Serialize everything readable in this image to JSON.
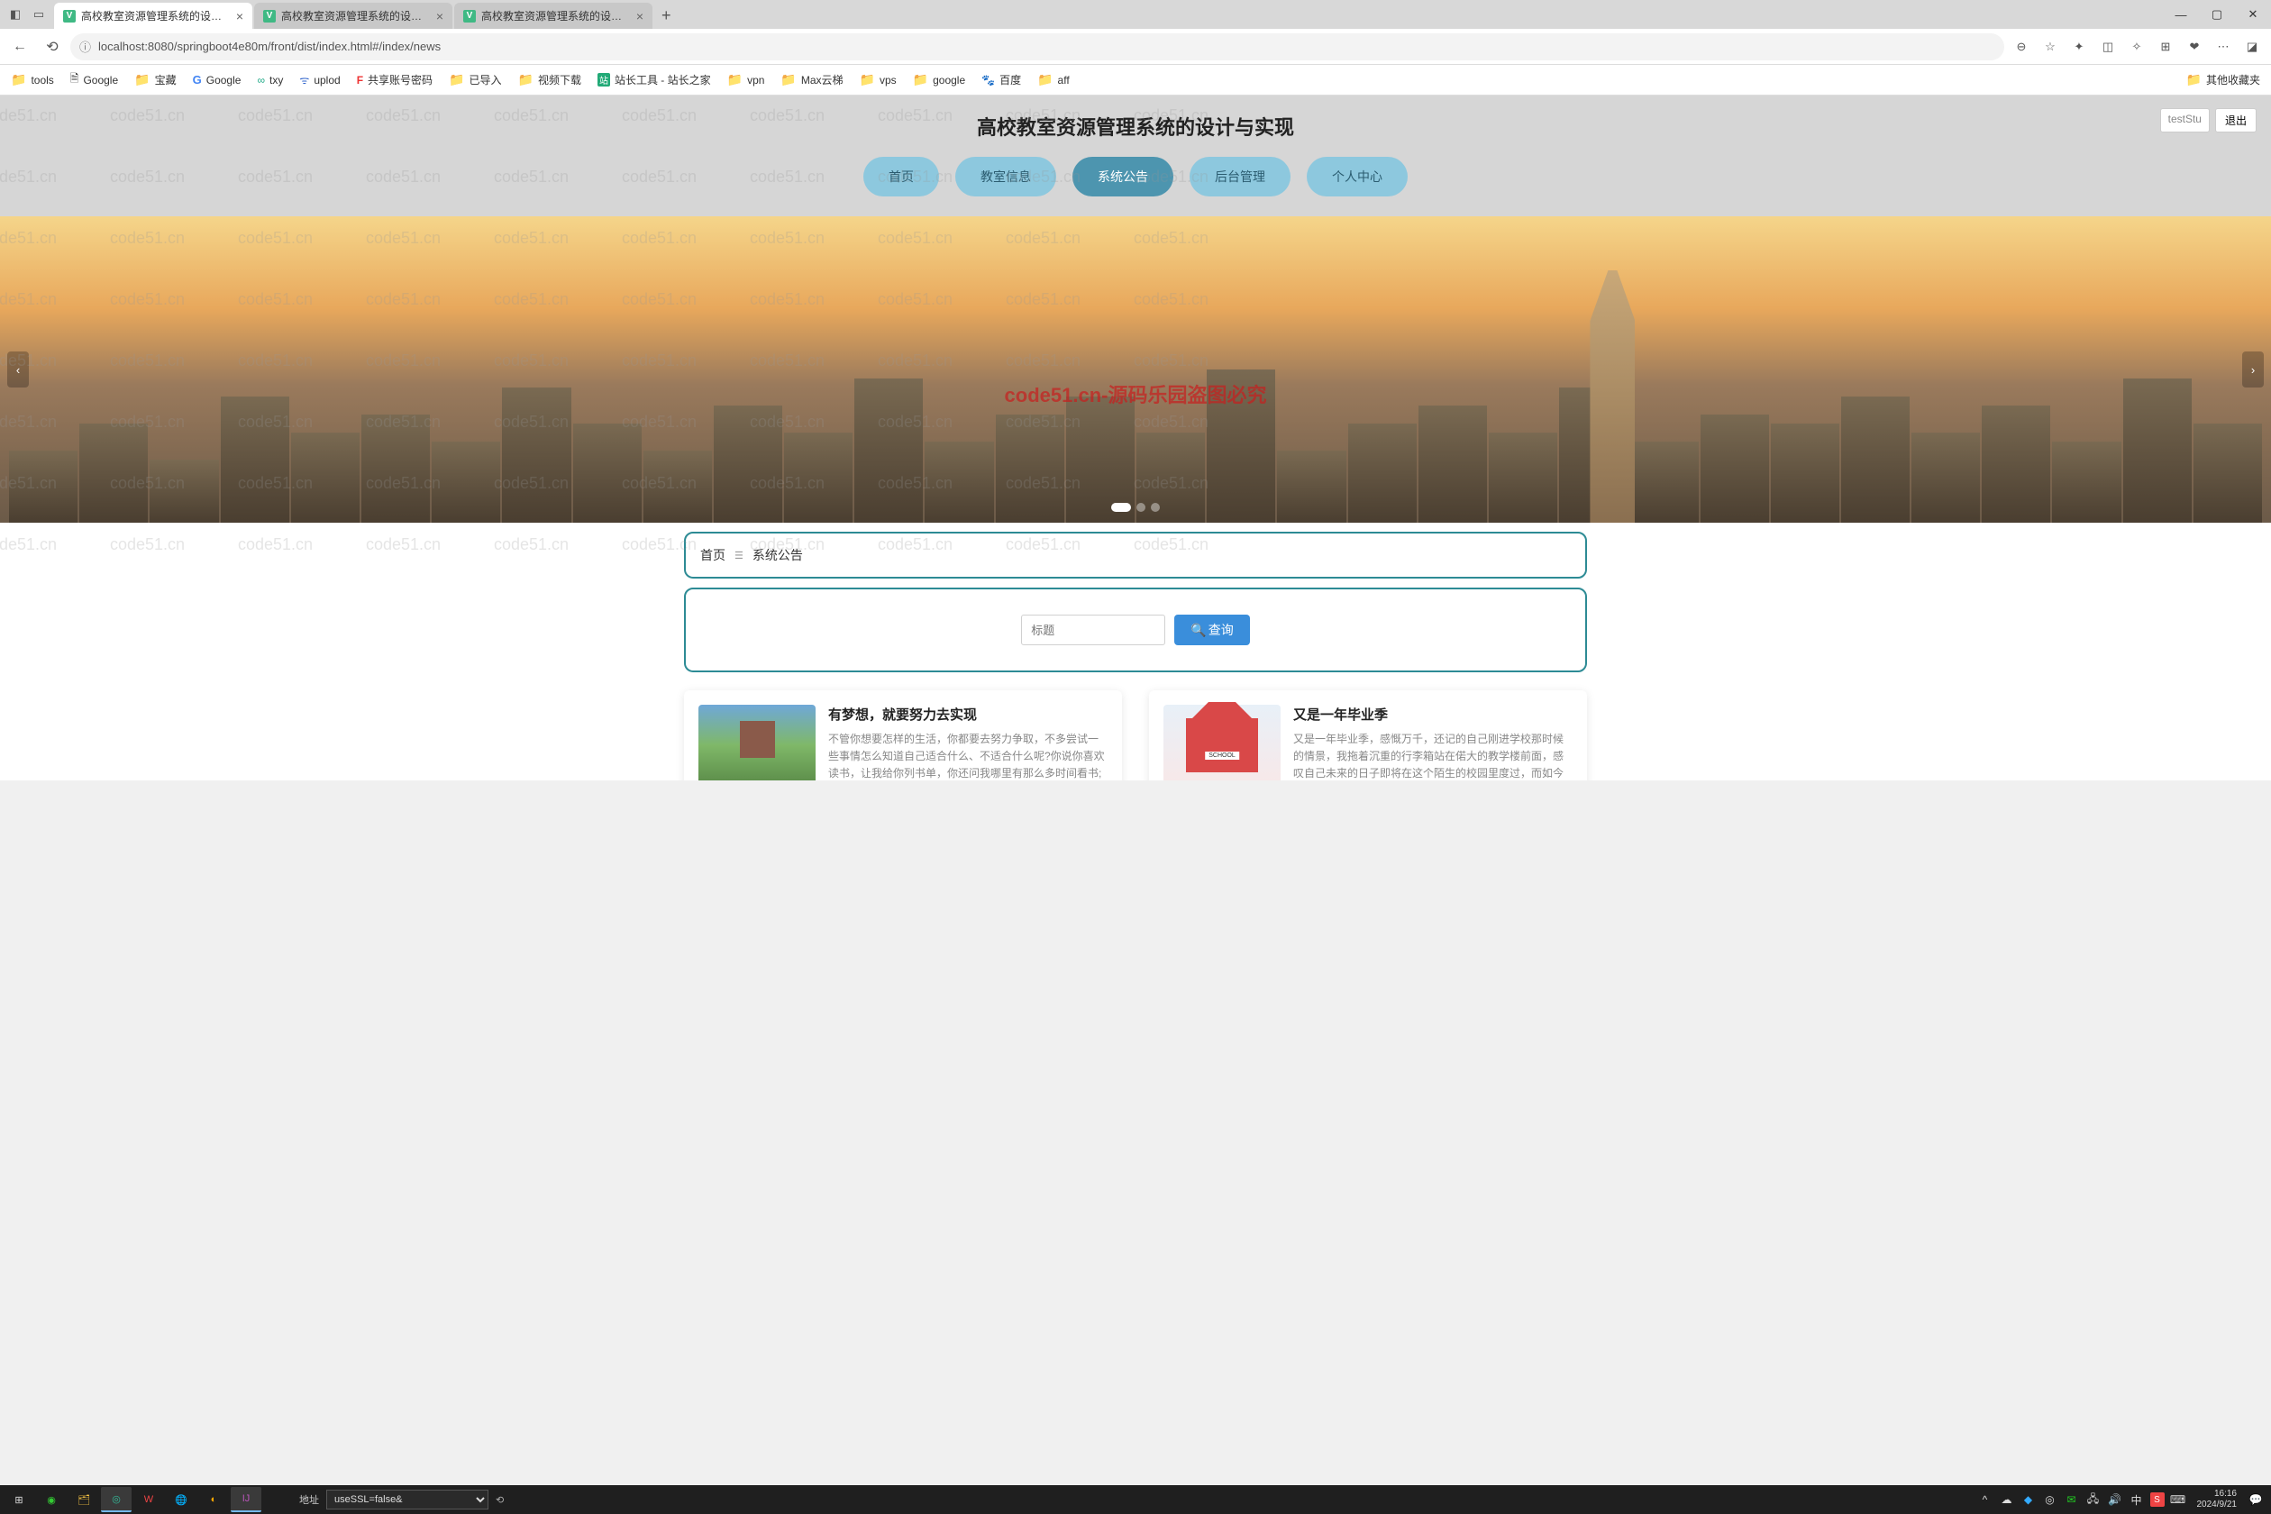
{
  "browser": {
    "tabs": [
      {
        "title": "高校教室资源管理系统的设计与实",
        "active": true
      },
      {
        "title": "高校教室资源管理系统的设计与实",
        "active": false
      },
      {
        "title": "高校教室资源管理系统的设计与实",
        "active": false
      }
    ],
    "url": "localhost:8080/springboot4e80m/front/dist/index.html#/index/news",
    "bookmarks": [
      {
        "label": "tools",
        "icon": "folder"
      },
      {
        "label": "Google",
        "icon": "page"
      },
      {
        "label": "宝藏",
        "icon": "folder"
      },
      {
        "label": "Google",
        "icon": "g"
      },
      {
        "label": "txy",
        "icon": "cloud"
      },
      {
        "label": "uplod",
        "icon": "upload"
      },
      {
        "label": "共享账号密码",
        "icon": "fx"
      },
      {
        "label": "已导入",
        "icon": "folder"
      },
      {
        "label": "视频下载",
        "icon": "folder"
      },
      {
        "label": "站长工具 - 站长之家",
        "icon": "zz"
      },
      {
        "label": "vpn",
        "icon": "folder"
      },
      {
        "label": "Max云梯",
        "icon": "folder"
      },
      {
        "label": "vps",
        "icon": "folder"
      },
      {
        "label": "google",
        "icon": "folder"
      },
      {
        "label": "百度",
        "icon": "baidu"
      },
      {
        "label": "aff",
        "icon": "folder"
      }
    ],
    "other_bookmarks": "其他收藏夹"
  },
  "site": {
    "title": "高校教室资源管理系统的设计与实现",
    "user": "testStu",
    "logout": "退出",
    "nav": [
      {
        "label": "首页",
        "active": false
      },
      {
        "label": "教室信息",
        "active": false
      },
      {
        "label": "系统公告",
        "active": true
      },
      {
        "label": "后台管理",
        "active": false
      },
      {
        "label": "个人中心",
        "active": false
      }
    ]
  },
  "hero": {
    "watermark_center": "code51.cn-源码乐园盗图必究"
  },
  "breadcrumb": {
    "home": "首页",
    "current": "系统公告"
  },
  "search": {
    "placeholder": "标题",
    "button": "查询"
  },
  "news": [
    {
      "title": "有梦想，就要努力去实现",
      "desc": "不管你想要怎样的生活，你都要去努力争取，不多尝试一些事情怎么知道自己适合什么、不适合什么呢?你说你喜欢读书，让我给你列书单，你还问我哪里有那么多时间看书;"
    },
    {
      "title": "又是一年毕业季",
      "desc": "又是一年毕业季，感慨万千，还记的自己刚进学校那时候的情景，我拖着沉重的行李箱站在偌大的教学楼前面，感叹自己未来的日子即将在这个陌生的校园里度过，而如今"
    }
  ],
  "watermark_text": "code51.cn",
  "taskbar": {
    "addr_label": "地址",
    "addr_value": "useSSL=false&",
    "time": "16:16",
    "date": "2024/9/21"
  }
}
